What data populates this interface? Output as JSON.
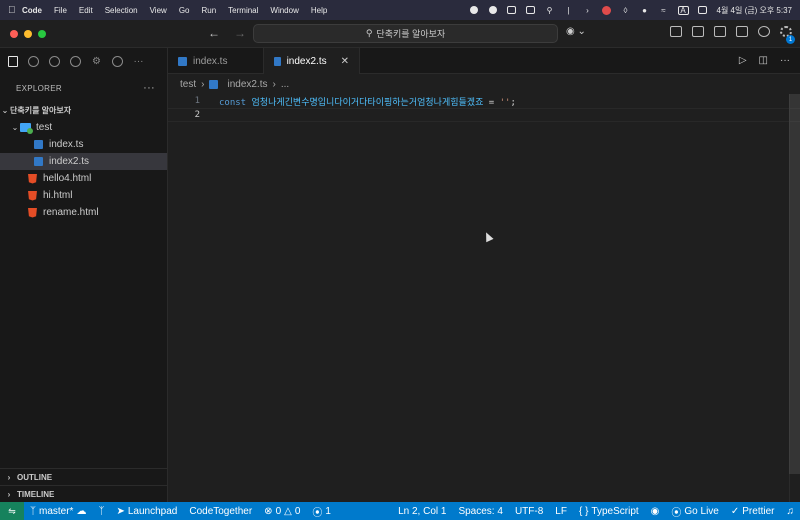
{
  "menubar": {
    "app": "Code",
    "items": [
      "File",
      "Edit",
      "Selection",
      "View",
      "Go",
      "Run",
      "Terminal",
      "Window",
      "Help"
    ],
    "clock": "4월 4일 (금) 오후 5:37",
    "input_badge": "A"
  },
  "titlebar": {
    "search_text": "단축키를 알아보자",
    "badge_count": "1"
  },
  "sidebar": {
    "header": "EXPLORER",
    "more": "···",
    "root": "단축키를 알아보자",
    "folder": "test",
    "files_in_folder": [
      "index.ts",
      "index2.ts"
    ],
    "files_root": [
      "hello4.html",
      "hi.html",
      "rename.html"
    ],
    "outline": "OUTLINE",
    "timeline": "TIMELINE"
  },
  "tabs": [
    {
      "label": "index.ts",
      "active": false
    },
    {
      "label": "index2.ts",
      "active": true
    }
  ],
  "breadcrumb": {
    "folder": "test",
    "file": "index2.ts",
    "tail": "..."
  },
  "editor": {
    "lines": [
      {
        "number": "1",
        "keyword": "const",
        "identifier": "엄청나게긴변수명입니다이거다타이핑하는거엄청나게힘들겠죠",
        "operator": " = ",
        "string": "''",
        "end": ";"
      },
      {
        "number": "2"
      }
    ]
  },
  "statusbar": {
    "branch": "master*",
    "launchpad": "Launchpad",
    "codetogether": "CodeTogether",
    "errors": "0",
    "warnings": "0",
    "ports": "1",
    "position": "Ln 2, Col 1",
    "spaces": "Spaces: 4",
    "encoding": "UTF-8",
    "eol": "LF",
    "language": "TypeScript",
    "golive": "Go Live",
    "prettier": "Prettier"
  },
  "colors": {
    "statusbar": "#007acc",
    "accent": "#0078d4"
  }
}
